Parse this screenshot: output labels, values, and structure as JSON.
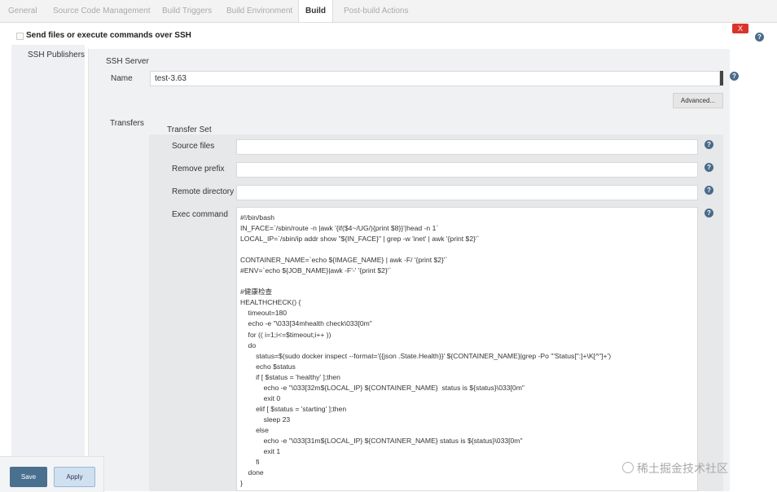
{
  "tabs": [
    "General",
    "Source Code Management",
    "Build Triggers",
    "Build Environment",
    "Build",
    "Post-build Actions"
  ],
  "active_tab": "Build",
  "section_title": "Send files or execute commands over SSH",
  "close_label": "X",
  "help_glyph": "?",
  "labels": {
    "ssh_publishers": "SSH Publishers",
    "ssh_server": "SSH Server",
    "name": "Name",
    "transfers": "Transfers",
    "transfer_set": "Transfer Set",
    "source_files": "Source files",
    "remove_prefix": "Remove prefix",
    "remote_directory": "Remote directory",
    "exec_command": "Exec command"
  },
  "name_value": "test-3.63",
  "advanced_label": "Advanced...",
  "exec_lines": [
    "#!/bin/bash",
    "IN_FACE=`/sbin/route -n |awk '{if($4~/UG/){print $8}}'|head -n 1`",
    "LOCAL_IP=`/sbin/ip addr show \"${IN_FACE}\" | grep -w 'inet' | awk '{print $2}'`",
    "",
    "CONTAINER_NAME=`echo ${IMAGE_NAME} | awk -F/ '{print $2}'`",
    "#ENV=`echo ${JOB_NAME}|awk -F'-' '{print $2}'`",
    "",
    "#健康检查",
    "HEALTHCHECK() {",
    "    timeout=180",
    "    echo -e \"\\033[34mhealth check\\033[0m\"",
    "    for (( i=1;i<=$timeout;i++ ))",
    "    do",
    "        status=$(sudo docker inspect --format='{{json .State.Health}}' ${CONTAINER_NAME}|grep -Po '\"Status[\":]+\\K[^\"]+')",
    "        echo $status",
    "        if [ $status = 'healthy' ];then",
    "            echo -e \"\\033[32m${LOCAL_IP} ${CONTAINER_NAME}  status is ${status}\\033[0m\"",
    "            exit 0",
    "        elif [ $status = 'starting' ];then",
    "            sleep 23",
    "        else",
    "            echo -e \"\\033[31m${LOCAL_IP} ${CONTAINER_NAME} status is ${status}\\033[0m\"",
    "            exit 1",
    "        fi",
    "    done",
    "}"
  ],
  "save_label": "Save",
  "apply_label": "Apply",
  "watermark": "稀土掘金技术社区"
}
